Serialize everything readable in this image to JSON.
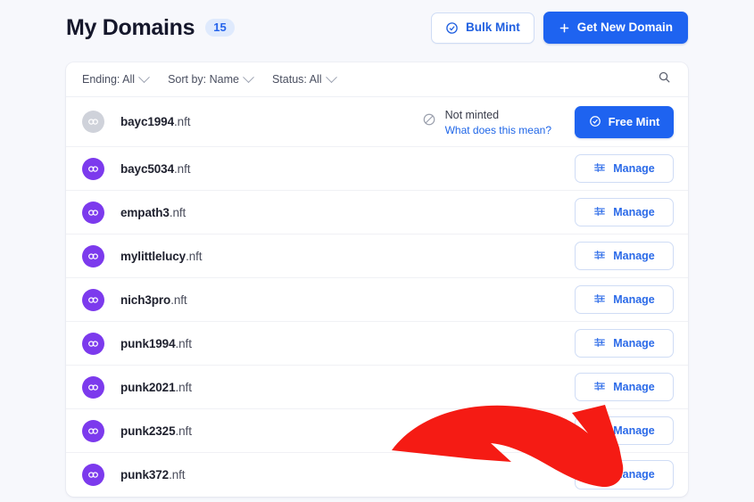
{
  "header": {
    "title": "My Domains",
    "count_badge": "15",
    "bulk_mint_label": "Bulk Mint",
    "get_new_domain_label": "Get New Domain"
  },
  "filters": [
    {
      "label": "Ending: All",
      "name": "filter-ending"
    },
    {
      "label": "Sort by: Name",
      "name": "filter-sort-by"
    },
    {
      "label": "Status: All",
      "name": "filter-status"
    }
  ],
  "search": {
    "icon": "search-icon"
  },
  "rows": [
    {
      "name": "bayc1994",
      "tld": ".nft",
      "minted": false,
      "avatar_color": "#cfd2da",
      "status_label": "Not minted",
      "status_link": "What does this mean?",
      "action_label": "Free Mint"
    },
    {
      "name": "bayc5034",
      "tld": ".nft",
      "minted": true,
      "avatar_color": "#7c3aed",
      "action_label": "Manage"
    },
    {
      "name": "empath3",
      "tld": ".nft",
      "minted": true,
      "avatar_color": "#7c3aed",
      "action_label": "Manage"
    },
    {
      "name": "mylittlelucy",
      "tld": ".nft",
      "minted": true,
      "avatar_color": "#7c3aed",
      "action_label": "Manage"
    },
    {
      "name": "nich3pro",
      "tld": ".nft",
      "minted": true,
      "avatar_color": "#7c3aed",
      "action_label": "Manage"
    },
    {
      "name": "punk1994",
      "tld": ".nft",
      "minted": true,
      "avatar_color": "#7c3aed",
      "action_label": "Manage"
    },
    {
      "name": "punk2021",
      "tld": ".nft",
      "minted": true,
      "avatar_color": "#7c3aed",
      "action_label": "Manage"
    },
    {
      "name": "punk2325",
      "tld": ".nft",
      "minted": true,
      "avatar_color": "#7c3aed",
      "action_label": "Manage"
    },
    {
      "name": "punk372",
      "tld": ".nft",
      "minted": true,
      "avatar_color": "#7c3aed",
      "action_label": "Manage"
    }
  ],
  "annotation": {
    "type": "curved-arrow",
    "color": "#f51b14",
    "points_to": "Manage"
  },
  "colors": {
    "page_background": "#f7f8fc",
    "card_background": "#ffffff",
    "primary_blue": "#1e63f0",
    "link_blue": "#1f66e8",
    "badge_blue_bg": "#dfeafd",
    "avatar_purple": "#7c3aed",
    "avatar_gray": "#cfd2da",
    "annotation_red": "#f51b14"
  }
}
